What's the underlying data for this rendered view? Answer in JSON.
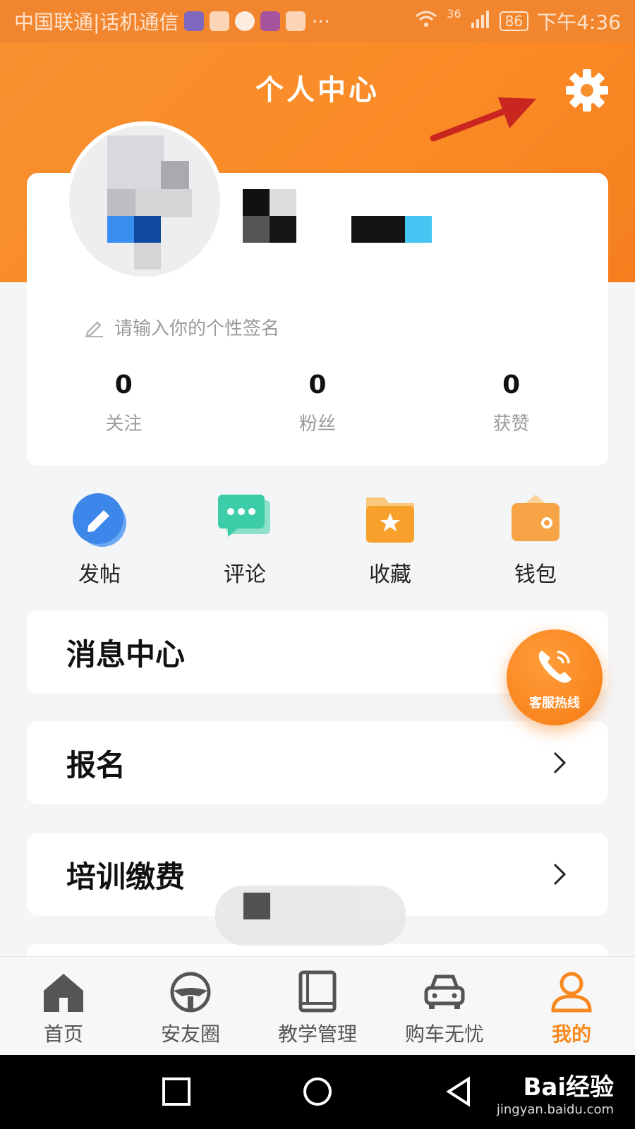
{
  "status_bar": {
    "carrier": "中国联通|话机通信",
    "dots": "···",
    "network": "36",
    "battery": "86",
    "time": "下午4:36"
  },
  "header": {
    "title": "个人中心"
  },
  "profile": {
    "signature_placeholder": "请输入你的个性签名",
    "stats": [
      {
        "value": "0",
        "label": "关注"
      },
      {
        "value": "0",
        "label": "粉丝"
      },
      {
        "value": "0",
        "label": "获赞"
      }
    ]
  },
  "quick_actions": [
    {
      "label": "发帖",
      "icon": "pencil-icon"
    },
    {
      "label": "评论",
      "icon": "comment-icon"
    },
    {
      "label": "收藏",
      "icon": "star-folder-icon"
    },
    {
      "label": "钱包",
      "icon": "wallet-icon"
    }
  ],
  "menu": [
    {
      "label": "消息中心"
    },
    {
      "label": "报名"
    },
    {
      "label": "培训缴费"
    }
  ],
  "hotline": {
    "label": "客服热线"
  },
  "tabs": [
    {
      "label": "首页",
      "icon": "home-icon"
    },
    {
      "label": "安友圈",
      "icon": "steering-wheel-icon"
    },
    {
      "label": "教学管理",
      "icon": "book-icon"
    },
    {
      "label": "购车无忧",
      "icon": "car-icon"
    },
    {
      "label": "我的",
      "icon": "user-icon",
      "active": true
    }
  ],
  "watermark": {
    "brand": "Bai经验",
    "url": "jingyan.baidu.com"
  },
  "colors": {
    "accent": "#f7891f",
    "header": "#f7902f"
  }
}
